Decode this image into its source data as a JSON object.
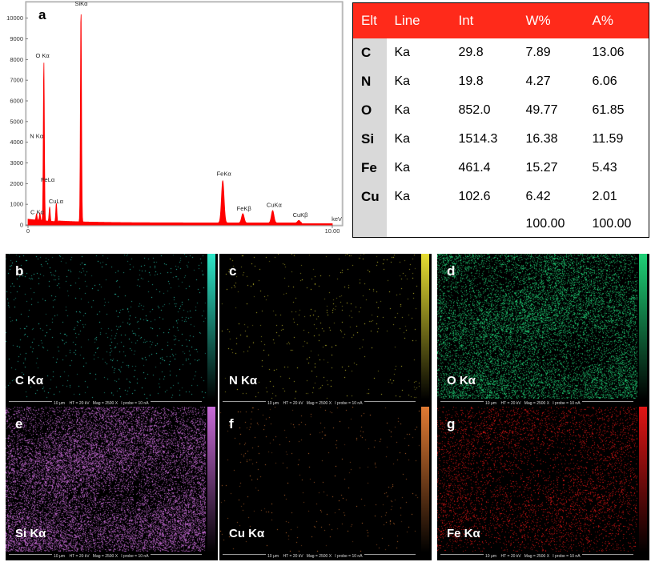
{
  "panel_labels": {
    "a": "a",
    "b": "b",
    "c": "c",
    "d": "d",
    "e": "e",
    "f": "f",
    "g": "g"
  },
  "chart_data": {
    "type": "line",
    "title": "",
    "xlabel": "keV",
    "ylabel": "",
    "xlim": [
      0,
      10.0
    ],
    "ylim": [
      0,
      10800
    ],
    "x_ticks": [
      "0",
      "10.00"
    ],
    "y_ticks": [
      "0",
      "1000",
      "2000",
      "3000",
      "4000",
      "5000",
      "6000",
      "7000",
      "8000",
      "9000",
      "10000"
    ],
    "series": [
      {
        "color": "#ff0000",
        "peaks": [
          {
            "x": 0.28,
            "y": 300
          },
          {
            "x": 0.39,
            "y": 350
          },
          {
            "x": 0.52,
            "y": 7700
          },
          {
            "x": 0.71,
            "y": 700
          },
          {
            "x": 0.93,
            "y": 900
          },
          {
            "x": 1.74,
            "y": 10350
          },
          {
            "x": 6.4,
            "y": 2050
          },
          {
            "x": 7.06,
            "y": 450
          },
          {
            "x": 8.04,
            "y": 600
          },
          {
            "x": 8.9,
            "y": 120
          }
        ]
      }
    ],
    "annotations": [
      {
        "text": "SiKα",
        "x": 1.74
      },
      {
        "text": "O Kα",
        "x": 0.52
      },
      {
        "text": "N Kα",
        "x": 0.39
      },
      {
        "text": "FeLα",
        "x": 0.71
      },
      {
        "text": "CuLα",
        "x": 0.93
      },
      {
        "text": "C Kα",
        "x": 0.28
      },
      {
        "text": "FeKα",
        "x": 6.4
      },
      {
        "text": "FeKβ",
        "x": 7.06
      },
      {
        "text": "CuKα",
        "x": 8.04
      },
      {
        "text": "CuKβ",
        "x": 8.9
      }
    ],
    "grid": false
  },
  "table": {
    "headers": [
      "Elt",
      "Line",
      "Int",
      "W%",
      "A%"
    ],
    "rows": [
      [
        "C",
        "Ka",
        "29.8",
        "7.89",
        "13.06"
      ],
      [
        "N",
        "Ka",
        "19.8",
        "4.27",
        "6.06"
      ],
      [
        "O",
        "Ka",
        "852.0",
        "49.77",
        "61.85"
      ],
      [
        "Si",
        "Ka",
        "1514.3",
        "16.38",
        "11.59"
      ],
      [
        "Fe",
        "Ka",
        "461.4",
        "15.27",
        "5.43"
      ],
      [
        "Cu",
        "Ka",
        "102.6",
        "6.42",
        "2.01"
      ]
    ],
    "totals": [
      "",
      "",
      "",
      "100.00",
      "100.00"
    ]
  },
  "maps": [
    {
      "letter": "b",
      "element": "C Kα",
      "color": "#2ee6c8",
      "density": 0.02,
      "footer": "10 μm    HT = 20 kV   Mag = 2500 X   I probe = 10 nA"
    },
    {
      "letter": "c",
      "element": "N Kα",
      "color": "#e6dd33",
      "density": 0.012,
      "footer": "10 μm    HT = 20 kV   Mag = 2500 X   I probe = 10 nA"
    },
    {
      "letter": "d",
      "element": "O Kα",
      "color": "#1fd076",
      "density": 0.33,
      "footer": "10 μm    HT = 20 kV   Mag = 2500 X   I probe = 10 nA"
    },
    {
      "letter": "e",
      "element": "Si Kα",
      "color": "#c86bd8",
      "density": 0.4,
      "footer": "10 μm    HT = 20 kV   Mag = 2500 X   I probe = 10 nA"
    },
    {
      "letter": "f",
      "element": "Cu Kα",
      "color": "#e07a33",
      "density": 0.01,
      "footer": "10 μm    HT = 20 kV   Mag = 2500 X   I probe = 10 nA"
    },
    {
      "letter": "g",
      "element": "Fe Kα",
      "color": "#e01515",
      "density": 0.15,
      "footer": "10 μm    HT = 20 kV   Mag = 2500 X   I probe = 10 nA"
    }
  ]
}
